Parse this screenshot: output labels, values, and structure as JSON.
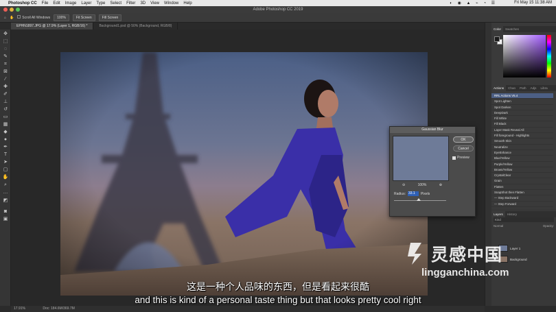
{
  "menubar": {
    "app_name": "Photoshop CC",
    "items": [
      "File",
      "Edit",
      "Image",
      "Layer",
      "Type",
      "Select",
      "Filter",
      "3D",
      "View",
      "Window",
      "Help"
    ],
    "clock": "Fri May 15  11:38 AM"
  },
  "window": {
    "title": "Adobe Photoshop CC 2019"
  },
  "options_bar": {
    "scroll_all_label": "Scroll All Windows",
    "zoom_btn": "100%",
    "fit_screen_btn": "Fit Screen",
    "fill_screen_btn": "Fill Screen"
  },
  "tabs": [
    {
      "label": "EPHN1897.JPG @ 17.9% (Layer 1, RGB/16) *"
    },
    {
      "label": "Background1.psd @ 50% (Background, RGB/8)"
    }
  ],
  "dialog": {
    "title": "Gaussian Blur",
    "ok": "OK",
    "cancel": "Cancel",
    "preview": "Preview",
    "zoom": "100%",
    "zoom_out": "⊖",
    "zoom_in": "⊕",
    "radius_label": "Radius:",
    "radius_value": "33.1",
    "units": "Pixels",
    "radius_fraction": 0.48
  },
  "panels": {
    "color_tabs": [
      "Color",
      "Swatches"
    ],
    "action_tabs": [
      "Actions",
      "Chan",
      "Path",
      "Adjs",
      "Libra"
    ],
    "actions": [
      "RRL Actions V5.4",
      "Spot Lighten",
      "Spot Darken",
      "DeepDark",
      "Fill White",
      "Fill Black",
      "Layer Mask Reveal All",
      "Fill foreground - Highlights",
      "Smooth Skin",
      "Neutralize",
      "EyeEnhance",
      "Blue/Yellow",
      "Purple/Yellow",
      "Brown/Yellow",
      "CrystalClear",
      "Grain",
      "Flatten",
      "SnapShot then Flatten",
      "— Step Backward",
      "— Step Forward"
    ],
    "layer_tabs": [
      "Layers",
      "History"
    ],
    "layers_search": "Kind",
    "layers_mode": "Normal",
    "layers_opacity": "Opacity:",
    "layer_rows": [
      {
        "name": "Layer 1"
      },
      {
        "name": "Background"
      }
    ]
  },
  "statusbar": {
    "zoom": "17.91%",
    "doc_info": "Doc: 184.6M/369.7M"
  },
  "subtitles": {
    "cn": "这是一种个人品味的东西，但是看起来很酷",
    "en": "and this is kind of a personal taste thing but that looks pretty cool right"
  },
  "watermark": {
    "cn": "灵感中国",
    "url": "lingganchina.com"
  }
}
